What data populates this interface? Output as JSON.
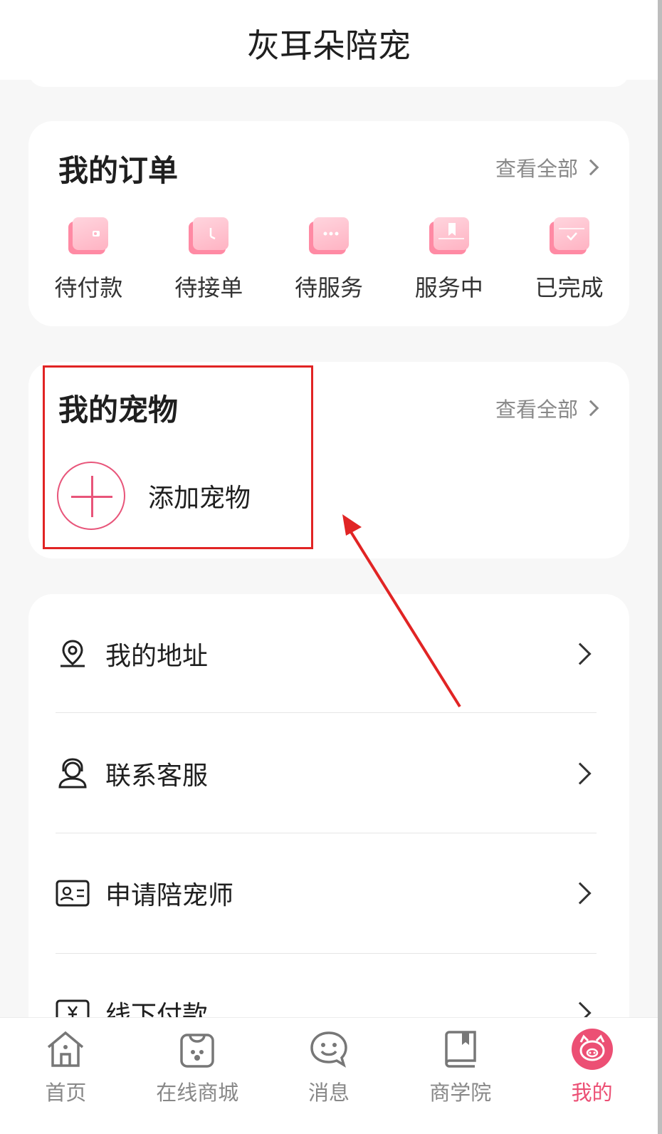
{
  "header": {
    "title": "灰耳朵陪宠"
  },
  "orders": {
    "title": "我的订单",
    "view_all": "查看全部",
    "items": [
      {
        "label": "待付款",
        "icon": "wallet-icon"
      },
      {
        "label": "待接单",
        "icon": "clock-icon"
      },
      {
        "label": "待服务",
        "icon": "chat-dots-icon"
      },
      {
        "label": "服务中",
        "icon": "bookmark-icon"
      },
      {
        "label": "已完成",
        "icon": "check-icon"
      }
    ]
  },
  "pets": {
    "title": "我的宠物",
    "view_all": "查看全部",
    "add_label": "添加宠物"
  },
  "menu": {
    "items": [
      {
        "label": "我的地址",
        "icon": "location-pin-icon"
      },
      {
        "label": "联系客服",
        "icon": "headset-icon"
      },
      {
        "label": "申请陪宠师",
        "icon": "id-card-icon"
      },
      {
        "label": "线下付款",
        "icon": "yuan-receipt-icon"
      }
    ]
  },
  "tabbar": {
    "items": [
      {
        "label": "首页",
        "icon": "home-icon"
      },
      {
        "label": "在线商城",
        "icon": "shopping-bag-icon"
      },
      {
        "label": "消息",
        "icon": "message-smile-icon"
      },
      {
        "label": "商学院",
        "icon": "book-icon"
      },
      {
        "label": "我的",
        "icon": "pig-avatar-icon",
        "active": true
      }
    ]
  },
  "colors": {
    "accent": "#ec4f74",
    "annotation": "#e12424",
    "background": "#f7f7f7"
  }
}
